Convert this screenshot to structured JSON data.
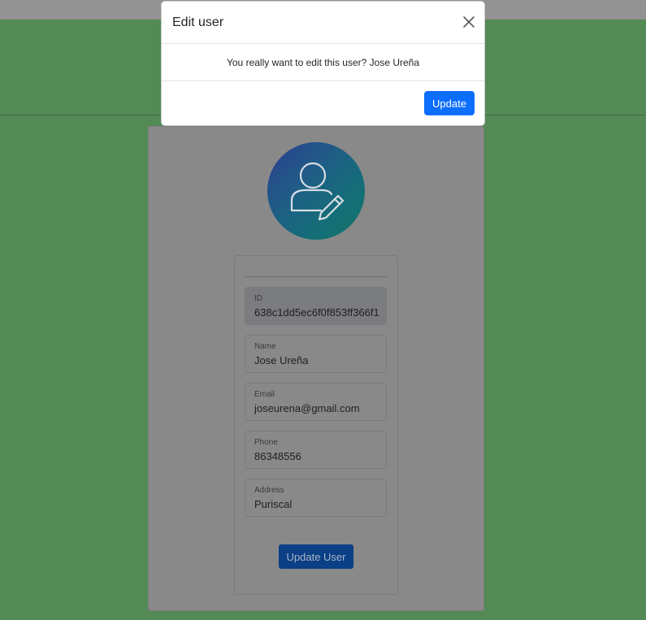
{
  "modal": {
    "title": "Edit user",
    "message": "You really want to edit this user? Jose Ureña",
    "update_label": "Update",
    "close_icon": "close-icon"
  },
  "profile": {
    "avatar_icon": "user-edit-icon",
    "fields": [
      {
        "label": "ID",
        "value": "638c1dd5ec6f0f853ff366f1"
      },
      {
        "label": "Name",
        "value": "Jose Ureña"
      },
      {
        "label": "Email",
        "value": "joseurena@gmail.com"
      },
      {
        "label": "Phone",
        "value": "86348556"
      },
      {
        "label": "Address",
        "value": "Puriscal"
      }
    ],
    "submit_label": "Update User"
  },
  "colors": {
    "backdrop_green": "#548a55",
    "primary": "#0d6efd"
  }
}
